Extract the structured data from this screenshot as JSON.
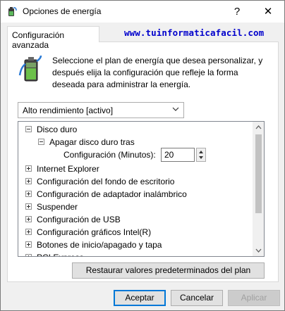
{
  "window": {
    "title": "Opciones de energía",
    "help_label": "?",
    "close_label": "✕"
  },
  "tab": {
    "label": "Configuración avanzada"
  },
  "watermark": "www.tuinformaticafacil.com",
  "description": "Seleccione el plan de energía que desea personalizar, y después elija la configuración que refleje la forma deseada para administrar la energía.",
  "plan_select": {
    "value": "Alto rendimiento [activo]"
  },
  "tree": {
    "disk": {
      "label": "Disco duro",
      "expanded": true
    },
    "turn_off_disk": {
      "label": "Apagar disco duro tras",
      "expanded": true
    },
    "setting": {
      "label": "Configuración (Minutos):",
      "value": "20"
    },
    "items": [
      "Internet Explorer",
      "Configuración del fondo de escritorio",
      "Configuración de adaptador inalámbrico",
      "Suspender",
      "Configuración de USB",
      "Configuración gráficos Intel(R)",
      "Botones de inicio/apagado y tapa",
      "PCI Express"
    ]
  },
  "buttons": {
    "restore": "Restaurar valores predeterminados del plan",
    "accept": "Aceptar",
    "cancel": "Cancelar",
    "apply": "Aplicar"
  },
  "icons": {
    "app": "power-options-icon",
    "battery": "battery-plug-icon",
    "accent_color": "#0078d7",
    "watermark_color": "#0000cc"
  }
}
